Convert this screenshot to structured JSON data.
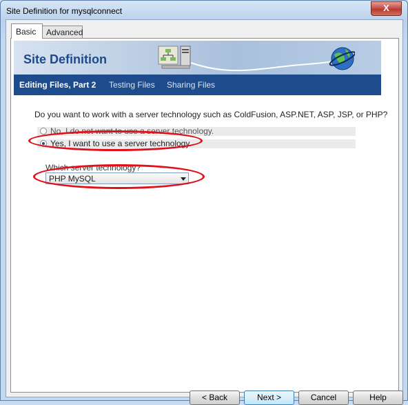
{
  "window": {
    "title": "Site Definition for mysqlconnect",
    "close_label": "X"
  },
  "tabs": [
    {
      "label": "Basic"
    },
    {
      "label": "Advanced"
    }
  ],
  "banner": {
    "title": "Site Definition"
  },
  "nav": [
    {
      "label": "Editing Files, Part 2",
      "active": true
    },
    {
      "label": "Testing Files",
      "active": false
    },
    {
      "label": "Sharing Files",
      "active": false
    }
  ],
  "form": {
    "question": "Do you want to work with a server technology such as ColdFusion, ASP.NET, ASP, JSP, or PHP?",
    "options": [
      {
        "label": "No, I do not want to use a server technology.",
        "checked": false
      },
      {
        "label": "Yes, I want to use a server technology.",
        "checked": true
      }
    ],
    "which_label": "Which server technology?",
    "select_value": "PHP MySQL"
  },
  "buttons": {
    "back": "< Back",
    "next": "Next >",
    "cancel": "Cancel",
    "help": "Help"
  },
  "colors": {
    "nav_bg": "#1e4b8c",
    "banner_title": "#1e4a8c",
    "annotation": "#e0101a"
  }
}
